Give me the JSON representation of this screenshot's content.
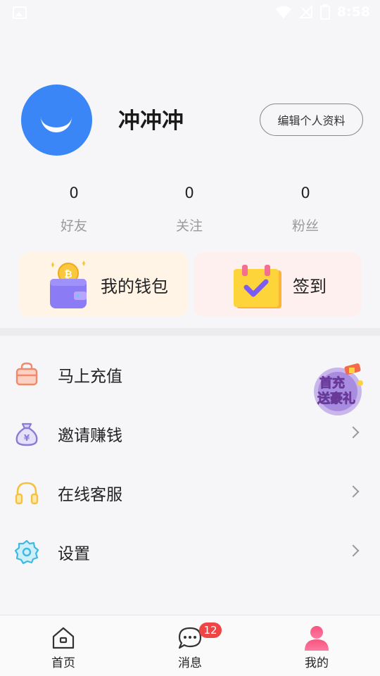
{
  "status_bar": {
    "time": "8:58",
    "icons": [
      "image-notification-icon",
      "wifi-icon",
      "signal-icon",
      "battery-icon"
    ]
  },
  "profile": {
    "username": "冲冲冲",
    "edit_button_label": "编辑个人资料",
    "avatar_color": "#3a86f7"
  },
  "stats": [
    {
      "value": "0",
      "label": "好友"
    },
    {
      "value": "0",
      "label": "关注"
    },
    {
      "value": "0",
      "label": "粉丝"
    }
  ],
  "cards": {
    "wallet_label": "我的钱包",
    "signin_label": "签到"
  },
  "menu": [
    {
      "label": "马上充值",
      "icon": "shopping-bag-icon"
    },
    {
      "label": "邀请赚钱",
      "icon": "money-bag-icon"
    },
    {
      "label": "在线客服",
      "icon": "headset-icon"
    },
    {
      "label": "设置",
      "icon": "gear-icon"
    }
  ],
  "promo": {
    "line1": "首充",
    "line2": "送豪礼"
  },
  "tabbar": {
    "tabs": [
      {
        "label": "首页",
        "icon": "home-icon"
      },
      {
        "label": "消息",
        "icon": "chat-icon",
        "badge": "12"
      },
      {
        "label": "我的",
        "icon": "user-icon"
      }
    ]
  },
  "colors": {
    "accent_blue": "#3a86f7",
    "badge_red": "#f04545",
    "wallet_bg": "#fff4e6",
    "signin_bg": "#fff0f0",
    "active_tab_pink": "#f7467a"
  }
}
